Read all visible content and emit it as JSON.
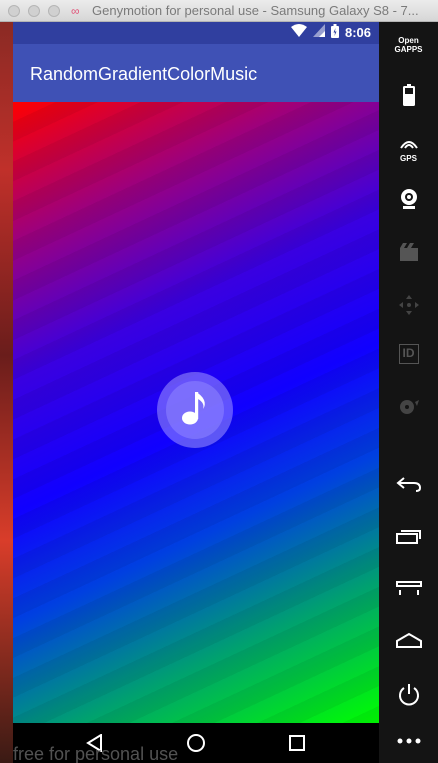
{
  "window": {
    "title": "Genymotion for personal use - Samsung Galaxy S8 - 7..."
  },
  "status_bar": {
    "time": "8:06"
  },
  "app": {
    "title": "RandomGradientColorMusic"
  },
  "sidebar": {
    "open_gapps_line1": "Open",
    "open_gapps_line2": "GAPPS",
    "gps_label": "GPS",
    "id_label": "ID"
  },
  "watermark": "free for personal use",
  "colors": {
    "status_bar": "#303f9f",
    "app_bar": "#3f51b5",
    "gradient_start": "#ff0000",
    "gradient_mid": "#1000ff",
    "gradient_end": "#00ff00",
    "sidebar_bg": "#141414"
  },
  "icons": {
    "center": "music-note-icon",
    "nav": [
      "back-icon",
      "home-icon",
      "recents-icon"
    ]
  }
}
